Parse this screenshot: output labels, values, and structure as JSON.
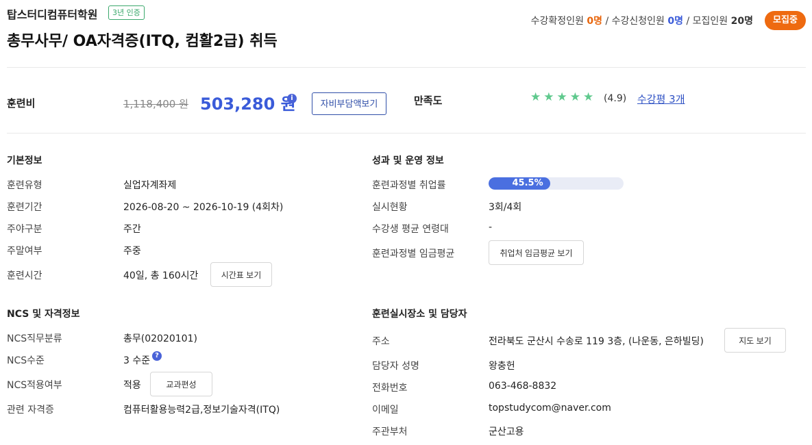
{
  "header": {
    "academy_name": "탑스터디컴퓨터학원",
    "cert_badge": "3년 인증",
    "course_title": "총무사무/ OA자격증(ITQ, 컴활2급) 취득",
    "enroll": {
      "confirmed_label": "수강확정인원",
      "confirmed_value": "0명",
      "applied_label": "수강신청인원",
      "applied_value": "0명",
      "recruit_label": "모집인원",
      "recruit_value": "20명",
      "separator": "/"
    },
    "status": "모집중"
  },
  "fee": {
    "label": "훈련비",
    "original": "1,118,400 원",
    "current": "503,280 원",
    "info_icon": "i",
    "self_pay_button": "자비부담액보기"
  },
  "satisfaction": {
    "label": "만족도",
    "stars": 5,
    "star_glyph": "★",
    "rating": "(4.9)",
    "review_link": "수강평 3개",
    "star_color": "#5fc98d"
  },
  "basic_info": {
    "title": "기본정보",
    "rows": [
      {
        "label": "훈련유형",
        "value": "실업자계좌제"
      },
      {
        "label": "훈련기간",
        "value": "2026-08-20 ~ 2026-10-19 (4회차)"
      },
      {
        "label": "주야구분",
        "value": "주간"
      },
      {
        "label": "주말여부",
        "value": "주중"
      },
      {
        "label": "훈련시간",
        "value": "40일, 총 160시간",
        "button": "시간표 보기"
      }
    ]
  },
  "performance": {
    "title": "성과 및 운영 정보",
    "rows": [
      {
        "label": "훈련과정별 취업률",
        "value": "45.5%",
        "fraction": 0.455
      },
      {
        "label": "실시현황",
        "value": "3회/4회"
      },
      {
        "label": "수강생 평균 연령대",
        "value": "-"
      },
      {
        "label": "훈련과정별 임금평균",
        "button": "취업처 임금평균 보기"
      }
    ]
  },
  "ncs": {
    "title": "NCS 및 자격정보",
    "rows": [
      {
        "label": "NCS직무분류",
        "value": "총무(02020101)"
      },
      {
        "label": "NCS수준",
        "value": "3 수준",
        "icon": "?"
      },
      {
        "label": "NCS적용여부",
        "value": "적용",
        "button": "교과편성"
      },
      {
        "label": "관련 자격증",
        "value": "컴퓨터활용능력2급,정보기술자격(ITQ)"
      }
    ]
  },
  "location": {
    "title": "훈련실시장소 및 담당자",
    "rows": [
      {
        "label": "주소",
        "value": "전라북도 군산시 수송로 119 3층, (나운동, 은하빌딩)",
        "button": "지도 보기"
      },
      {
        "label": "담당자 성명",
        "value": "왕충헌"
      },
      {
        "label": "전화번호",
        "value": "063-468-8832"
      },
      {
        "label": "이메일",
        "value": "topstudycom@naver.com"
      },
      {
        "label": "주관부처",
        "value": "군산고용"
      }
    ]
  },
  "colors": {
    "accent_blue": "#3a5bd9",
    "status_orange": "#ee6a10",
    "badge_green": "#3aa86b"
  }
}
